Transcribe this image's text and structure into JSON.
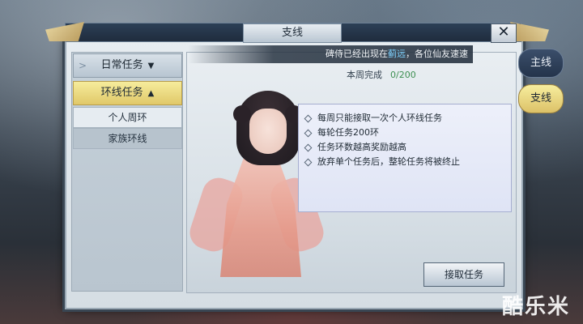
{
  "window": {
    "title": "支线",
    "close_symbol": "✕"
  },
  "sidebar": {
    "categories": [
      {
        "label": "日常任务",
        "expanded": false
      },
      {
        "label": "环线任务",
        "expanded": true
      }
    ],
    "subitems": [
      {
        "label": "个人周环",
        "selected": true
      },
      {
        "label": "家族环线",
        "selected": false
      }
    ]
  },
  "marquee": {
    "prefix": "碑侍已经出现在",
    "place": "蓟远",
    "suffix": "，各位仙友速速"
  },
  "progress": {
    "label": "本周完成",
    "value": "0/200"
  },
  "rules": [
    "每周只能接取一次个人环线任务",
    "每轮任务200环",
    "任务环数越高奖励越高",
    "放弃单个任务后，整轮任务将被终止"
  ],
  "accept_button": "接取任务",
  "right_tabs": [
    {
      "label": "主线",
      "active": false
    },
    {
      "label": "支线",
      "active": true
    }
  ],
  "watermark": "酷乐米",
  "icons": {
    "chevron": "chevron-right-icon",
    "expand": "triangle-down-icon",
    "collapse": "triangle-up-icon"
  }
}
